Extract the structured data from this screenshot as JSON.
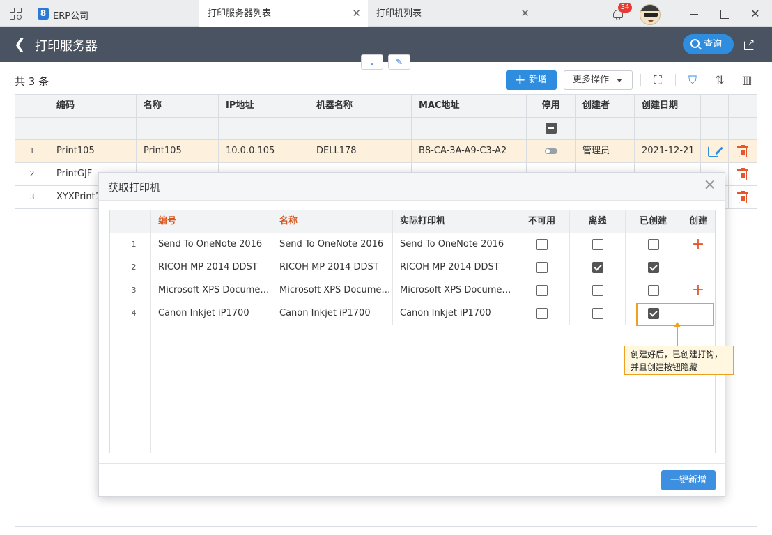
{
  "app": {
    "logo_text": "8",
    "title": "ERP公司"
  },
  "tabs": [
    {
      "label": "打印服务器列表",
      "active": true
    },
    {
      "label": "打印机列表",
      "active": false
    }
  ],
  "notifications": {
    "count": "34"
  },
  "header": {
    "title": "打印服务器",
    "query_label": "查询"
  },
  "toolbar": {
    "count_text": "共 3 条",
    "add_label": "新增",
    "more_label": "更多操作"
  },
  "table": {
    "columns": [
      "编码",
      "名称",
      "IP地址",
      "机器名称",
      "MAC地址",
      "停用",
      "创建者",
      "创建日期"
    ],
    "rows": [
      {
        "num": "1",
        "code": "Print105",
        "name": "Print105",
        "ip": "10.0.0.105",
        "machine": "DELL178",
        "mac": "B8-CA-3A-A9-C3-A2",
        "creator": "管理员",
        "date": "2021-12-21"
      },
      {
        "num": "2",
        "code": "PrintGJF",
        "name": "",
        "ip": "",
        "machine": "",
        "mac": "",
        "creator": "",
        "date": ""
      },
      {
        "num": "3",
        "code": "XYXPrint1",
        "name": "",
        "ip": "",
        "machine": "",
        "mac": "",
        "creator": "",
        "date": ""
      }
    ]
  },
  "modal": {
    "title": "获取打印机",
    "columns": [
      "编号",
      "名称",
      "实际打印机",
      "不可用",
      "离线",
      "已创建",
      "创建"
    ],
    "rows": [
      {
        "num": "1",
        "code": "Send To OneNote 2016",
        "name": "Send To OneNote 2016",
        "printer": "Send To OneNote 2016",
        "unavailable": false,
        "offline": false,
        "created": false,
        "can_create": true
      },
      {
        "num": "2",
        "code": "RICOH MP 2014 DDST",
        "name": "RICOH MP 2014 DDST",
        "printer": "RICOH MP 2014 DDST",
        "unavailable": false,
        "offline": true,
        "created": true,
        "can_create": false
      },
      {
        "num": "3",
        "code": "Microsoft XPS Docume…",
        "name": "Microsoft XPS Docume…",
        "printer": "Microsoft XPS Docume…",
        "unavailable": false,
        "offline": false,
        "created": false,
        "can_create": true
      },
      {
        "num": "4",
        "code": "Canon Inkjet iP1700",
        "name": "Canon Inkjet iP1700",
        "printer": "Canon Inkjet iP1700",
        "unavailable": false,
        "offline": false,
        "created": true,
        "can_create": false
      }
    ],
    "bulk_add_label": "一键新增"
  },
  "annotation": {
    "line1": "创建好后，已创建打钩，",
    "line2": "并且创建按钮隐藏"
  },
  "colors": {
    "primary": "#2f8de0",
    "header_bg": "#4a5361",
    "danger": "#e4572e",
    "highlight": "#f0a020",
    "row_highlight": "#fdf1dd"
  }
}
